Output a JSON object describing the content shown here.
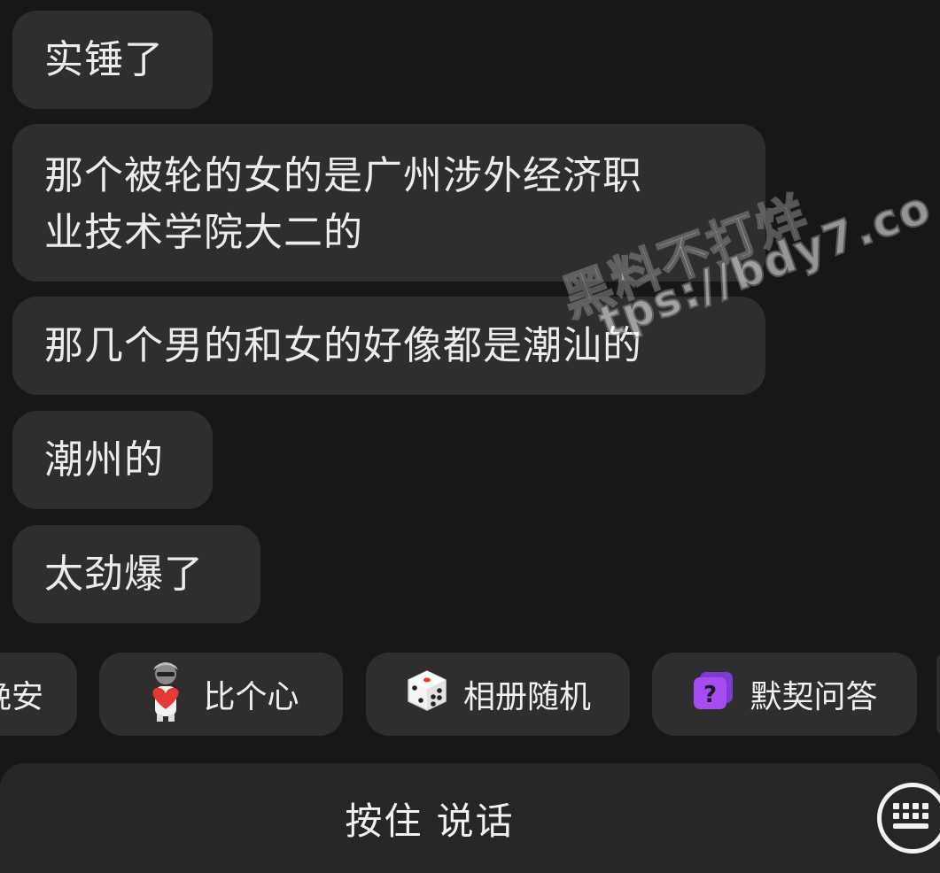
{
  "messages": [
    {
      "text": "实锤了"
    },
    {
      "line1": "那个被轮的女的是广州涉外经济职",
      "line2": "业技术学院大二的"
    },
    {
      "text": "那几个男的和女的好像都是潮汕的"
    },
    {
      "text": "潮州的"
    },
    {
      "text": "太劲爆了"
    }
  ],
  "quick_actions": [
    {
      "label": "晚安"
    },
    {
      "label": "比个心",
      "icon": "heart-sticker-icon"
    },
    {
      "label": "相册随机",
      "icon": "dice-icon"
    },
    {
      "label": "默契问答",
      "icon": "question-icon",
      "icon_color": "#a54cf5"
    }
  ],
  "input_bar": {
    "hold_to_talk_label": "按住 说话",
    "keyboard_icon": "keyboard-icon"
  },
  "watermark": {
    "line1": "黑料不打烊",
    "line2": "tps://bdy7.co"
  }
}
